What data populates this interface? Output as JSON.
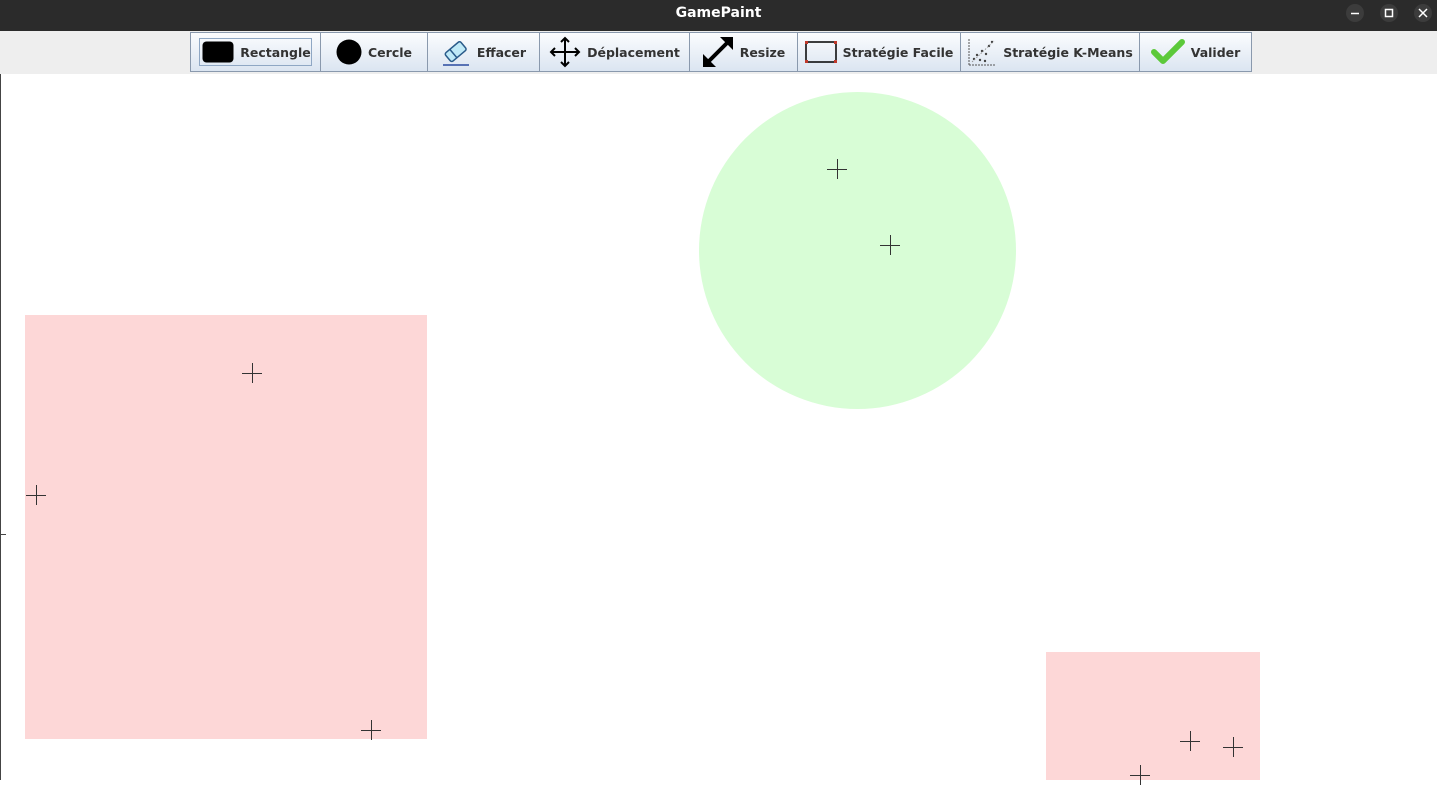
{
  "window": {
    "title": "GamePaint"
  },
  "toolbar": {
    "buttons": [
      {
        "id": "rectangle",
        "label": "Rectangle",
        "icon": "rounded-rectangle-icon",
        "selected": true
      },
      {
        "id": "cercle",
        "label": "Cercle",
        "icon": "filled-circle-icon"
      },
      {
        "id": "effacer",
        "label": "Effacer",
        "icon": "eraser-icon"
      },
      {
        "id": "deplacement",
        "label": "Déplacement",
        "icon": "move-arrows-icon"
      },
      {
        "id": "resize",
        "label": "Resize",
        "icon": "diagonal-resize-icon"
      },
      {
        "id": "strategie-facile",
        "label": "Stratégie Facile",
        "icon": "bounding-box-icon"
      },
      {
        "id": "strategie-kmeans",
        "label": "Stratégie K-Means",
        "icon": "scatter-plot-icon"
      },
      {
        "id": "valider",
        "label": "Valider",
        "icon": "green-checkmark-icon"
      }
    ]
  },
  "canvas": {
    "shapes": [
      {
        "type": "rectangle",
        "fill": "#fdd7d7"
      },
      {
        "type": "circle",
        "fill": "#d8fdd6"
      },
      {
        "type": "rectangle",
        "fill": "#fdd7d7"
      }
    ],
    "point_marker": "plus-icon"
  },
  "colors": {
    "titlebar": "#2b2b2b",
    "toolbar_background": "#eeeeee",
    "button_border": "#8a99ad",
    "rectangle_fill": "#fdd7d7",
    "circle_fill": "#d8fdd6",
    "valider_check": "#5cc93a"
  }
}
